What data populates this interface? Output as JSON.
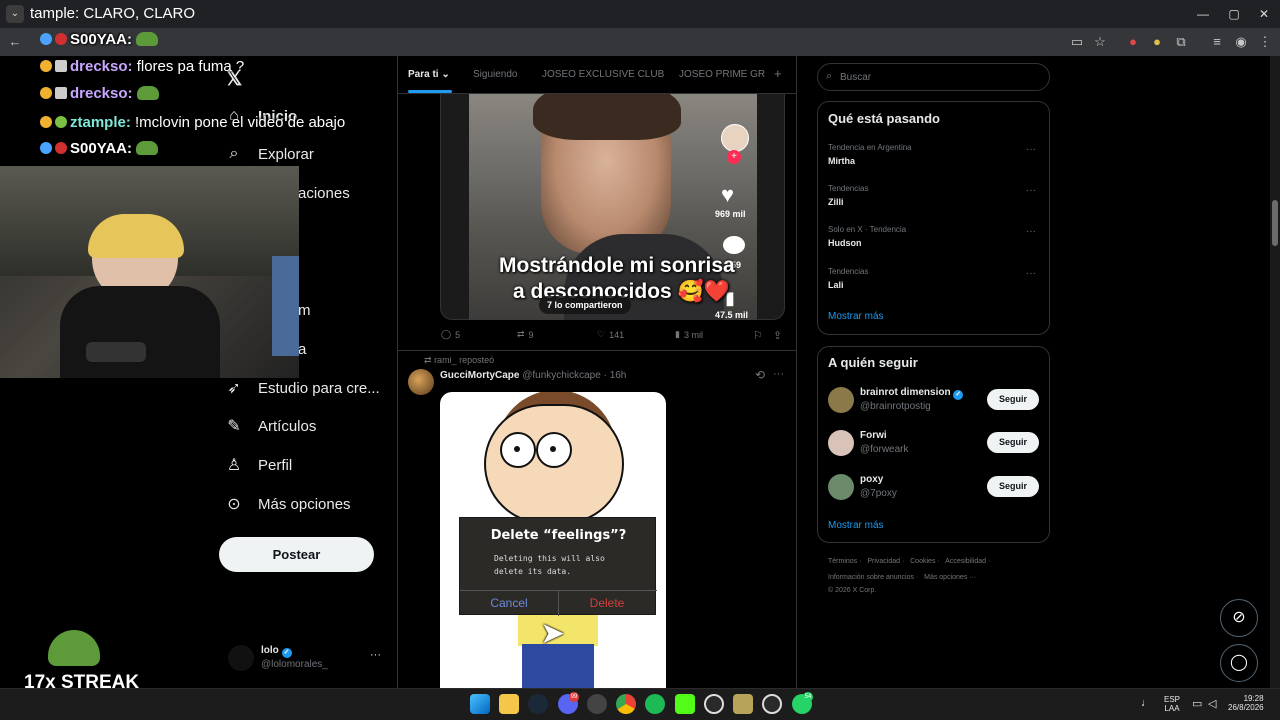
{
  "browser": {
    "tab_title": "tample: CLARO, CLARO"
  },
  "chat": [
    {
      "user": "S00YAA:",
      "msg": "",
      "emote": true,
      "user_color": "#ffffff"
    },
    {
      "user": "drecksо:",
      "msg": "flores pa fuma ?",
      "emote": false,
      "user_color": "#c9a6ff"
    },
    {
      "user": "drecksо:",
      "msg": "",
      "emote": true,
      "user_color": "#c9a6ff"
    },
    {
      "user": "ztample:",
      "msg": "!mclovin pone el video de abajo",
      "emote": false,
      "user_color": "#7ee8d8"
    },
    {
      "user": "S00YAA:",
      "msg": "",
      "emote": true,
      "user_color": "#ffffff"
    }
  ],
  "streak": {
    "label": "17x STREAK"
  },
  "nav": {
    "items": [
      {
        "label": "Inicio",
        "icon": "home-icon"
      },
      {
        "label": "Explorar",
        "icon": "search-icon"
      },
      {
        "label": "aciones",
        "icon": "bell-icon"
      },
      {
        "label": "m",
        "icon": "premium-icon"
      },
      {
        "label": "a",
        "icon": "verified-icon"
      },
      {
        "label": "Estudio para cre...",
        "icon": "rocket-icon"
      },
      {
        "label": "Artículos",
        "icon": "article-icon"
      },
      {
        "label": "Perfil",
        "icon": "person-icon"
      },
      {
        "label": "Más opciones",
        "icon": "more-circle-icon"
      }
    ],
    "post_label": "Postear",
    "account": {
      "name": "lolo",
      "handle": "@lolomorales_"
    }
  },
  "timeline": {
    "tabs": [
      "Para ti",
      "Siguiendo",
      "JOSEO EXCLUSIVE CLUB",
      "JOSEO PRIME GR"
    ],
    "post1": {
      "video_caption_1": "Mostrándole mi sonrisa",
      "video_caption_2": "a desconocidos 🥰❤️",
      "likes_overlay": "969 mil",
      "comments_overlay": "559",
      "saves_overlay": "47.5 mil",
      "shared_pill": "7 lo compartieron",
      "replies": "5",
      "reposts": "9",
      "likes": "141",
      "views": "3 mil"
    },
    "post2": {
      "reposted_by": "rami_ reposteó",
      "display_name": "GucciMortyCape",
      "handle": "@funkychickcape",
      "time": "16h",
      "dialog_title": "Delete “feelings”?",
      "dialog_body": "Deleting this will also delete its data.",
      "dialog_cancel": "Cancel",
      "dialog_delete": "Delete"
    }
  },
  "sidebar": {
    "search_placeholder": "Buscar",
    "trends_title": "Qué está pasando",
    "trends": [
      {
        "meta": "Tendencia en Argentina",
        "name": "Mirtha"
      },
      {
        "meta": "Tendencias",
        "name": "Zilli"
      },
      {
        "meta": "Solo en X · Tendencia",
        "name": "Hudson"
      },
      {
        "meta": "Tendencias",
        "name": "Lali"
      }
    ],
    "trends_more": "Mostrar más",
    "follow_title": "A quién seguir",
    "follow": [
      {
        "name": "brainrot dimension",
        "handle": "@brainrotpostig",
        "verified": true,
        "avatar_color": "#8a7a4a"
      },
      {
        "name": "Forwi",
        "handle": "@forweark",
        "verified": false,
        "avatar_color": "#d9c3b8"
      },
      {
        "name": "poxy",
        "handle": "@7poxy",
        "verified": false,
        "avatar_color": "#6a8a6a"
      }
    ],
    "follow_label": "Seguir",
    "follow_more": "Mostrar más",
    "footer_row1": [
      "Términos",
      "Privacidad",
      "Cookies",
      "Accesibilidad"
    ],
    "footer_row2": [
      "Información sobre anuncios",
      "Más opciones ···"
    ],
    "copyright": "© 2026 X Corp."
  },
  "taskbar": {
    "lang": "ESP",
    "lang2": "LAA",
    "time": "19:28",
    "date": "26/8/2026",
    "discord_badge": "99",
    "whatsapp_badge": "54"
  },
  "colors": {
    "accent": "#1d9bf0",
    "border": "#2f3336",
    "muted": "#71767b"
  }
}
